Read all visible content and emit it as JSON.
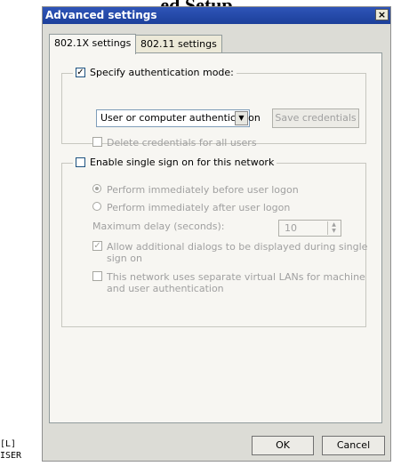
{
  "background_heading": "ed Setup",
  "window": {
    "title": "Advanced settings",
    "close_glyph": "×"
  },
  "tabs": [
    {
      "label": "802.1X settings",
      "active": true
    },
    {
      "label": "802.11 settings",
      "active": false
    }
  ],
  "auth_group": {
    "label": "Specify authentication mode:",
    "checked": true,
    "mode_value": "User or computer authentication",
    "save_button": "Save credentials",
    "delete_label": "Delete credentials for all users"
  },
  "sso_group": {
    "label": "Enable single sign on for this network",
    "checked": false,
    "radio_before": "Perform immediately before user logon",
    "radio_after": "Perform immediately after user logon",
    "delay_label": "Maximum delay (seconds):",
    "delay_value": "10",
    "allow_dialogs_line1": "Allow additional dialogs to be displayed during single",
    "allow_dialogs_line2": "sign on",
    "vlan_line1": "This network uses separate virtual LANs for machine",
    "vlan_line2": "and user authentication"
  },
  "footer": {
    "ok": "OK",
    "cancel": "Cancel"
  },
  "left_fragments": {
    "top": "[L]",
    "bottom": "ISER"
  }
}
